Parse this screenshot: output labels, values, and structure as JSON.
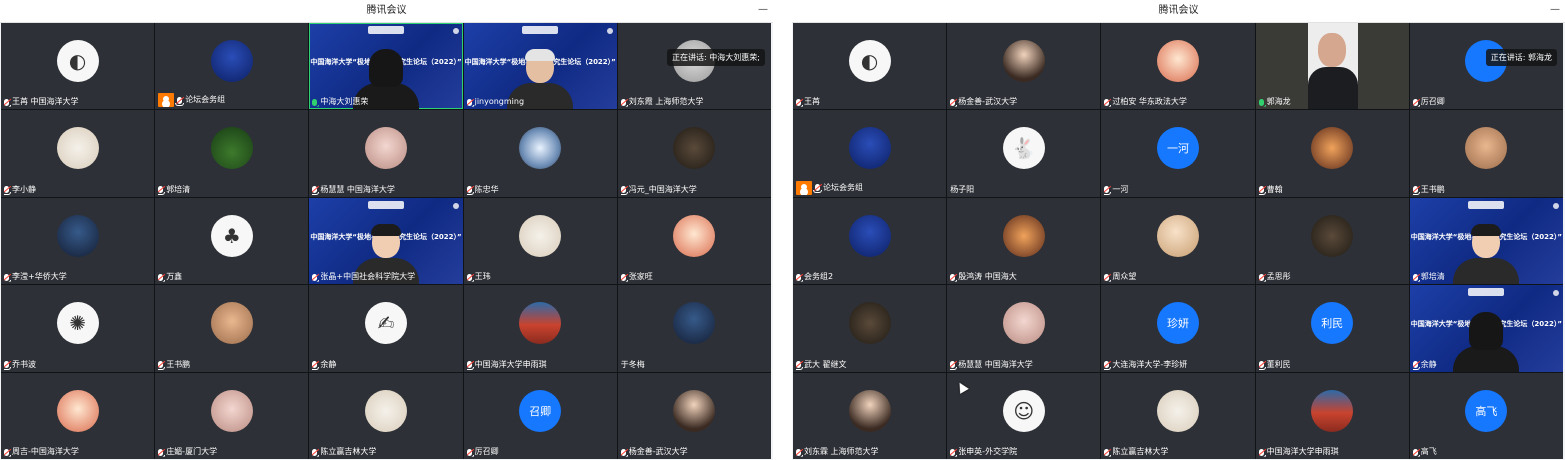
{
  "left": {
    "title": "腾讯会议",
    "speaking": "正在讲话: 中海大刘惠荣;",
    "tiles": [
      {
        "name": "王苒 中国海洋大学",
        "avatar": "white",
        "glyph": "◐",
        "mic": "muted"
      },
      {
        "name": "论坛会务组",
        "avatar": "navy",
        "host": true,
        "mic": "muted"
      },
      {
        "name": "中海大刘惠荣",
        "kind": "slide",
        "person": "women",
        "mic": "speaking",
        "highlight": true
      },
      {
        "name": "jinyongming",
        "kind": "slide",
        "person": "white-hair",
        "mic": "muted"
      },
      {
        "name": "刘东霞 上海师范大学",
        "avatar": "grey",
        "mic": "muted",
        "speaking_tag": true
      },
      {
        "name": "李小静",
        "avatar": "dog",
        "mic": "muted"
      },
      {
        "name": "郭培清",
        "avatar": "green",
        "mic": "muted"
      },
      {
        "name": "杨慧慧 中国海洋大学",
        "avatar": "pink",
        "mic": "muted"
      },
      {
        "name": "陈忠华",
        "avatar": "space",
        "mic": "muted"
      },
      {
        "name": "冯元_中国海洋大学",
        "avatar": "dark",
        "mic": "muted"
      },
      {
        "name": "李滢+华侨大学",
        "avatar": "night",
        "mic": "muted"
      },
      {
        "name": "万鑫",
        "avatar": "white",
        "glyph": "♣",
        "mic": "muted"
      },
      {
        "name": "张晶+中国社会科学院大学",
        "kind": "slide",
        "person": "glasses",
        "mic": "muted"
      },
      {
        "name": "王玮",
        "avatar": "dog",
        "mic": "muted"
      },
      {
        "name": "张家旺",
        "avatar": "cartoon",
        "mic": "muted"
      },
      {
        "name": "乔书波",
        "avatar": "white",
        "glyph": "✺",
        "mic": "muted"
      },
      {
        "name": "王书鹏",
        "avatar": "teddy",
        "mic": "muted"
      },
      {
        "name": "余静",
        "avatar": "white",
        "glyph": "✍",
        "mic": "muted"
      },
      {
        "name": "中国海洋大学申雨琪",
        "avatar": "wall",
        "mic": "muted"
      },
      {
        "name": "于冬梅",
        "avatar": "night",
        "mic": "none"
      },
      {
        "name": "周吉-中国海洋大学",
        "avatar": "cartoon",
        "mic": "muted"
      },
      {
        "name": "庄媚-厦门大学",
        "avatar": "pink",
        "mic": "muted"
      },
      {
        "name": "陈立赢吉林大学",
        "avatar": "dog",
        "mic": "muted"
      },
      {
        "name": "厉召卿",
        "avatar": "txt",
        "text": "召卿",
        "mic": "muted"
      },
      {
        "name": "杨金善-武汉大学",
        "avatar": "person",
        "mic": "muted"
      }
    ]
  },
  "right": {
    "title": "腾讯会议",
    "speaking": "正在讲话: 郭海龙",
    "tiles": [
      {
        "name": "王苒",
        "avatar": "white",
        "glyph": "◐",
        "mic": "muted"
      },
      {
        "name": "杨金善-武汉大学",
        "avatar": "person",
        "mic": "muted"
      },
      {
        "name": "过柏安 华东政法大学",
        "avatar": "cartoon",
        "mic": "muted"
      },
      {
        "name": "郭海龙",
        "kind": "camera",
        "mic": "speaking",
        "highlight": true
      },
      {
        "name": "厉召卿",
        "avatar": "txt",
        "text": "",
        "mic": "muted",
        "speaking_tag": true
      },
      {
        "name": "论坛会务组",
        "avatar": "navy",
        "host": true,
        "mic": "muted"
      },
      {
        "name": "杨子阳",
        "avatar": "white",
        "glyph": "🐇",
        "mic": "none"
      },
      {
        "name": "一河",
        "avatar": "txt",
        "text": "一河",
        "mic": "muted"
      },
      {
        "name": "曹翰",
        "avatar": "sunset",
        "mic": "muted"
      },
      {
        "name": "王书鹏",
        "avatar": "teddy",
        "mic": "muted"
      },
      {
        "name": "会务组2",
        "avatar": "navy",
        "mic": "muted"
      },
      {
        "name": "殷鸿涛 中国海大",
        "avatar": "sunset",
        "mic": "muted"
      },
      {
        "name": "周众望",
        "avatar": "cream",
        "mic": "muted"
      },
      {
        "name": "孟思彤",
        "avatar": "dark",
        "mic": "muted"
      },
      {
        "name": "郭培清",
        "kind": "slide",
        "person": "glasses",
        "mic": "muted"
      },
      {
        "name": "武大 翟继文",
        "avatar": "dark",
        "mic": "muted"
      },
      {
        "name": "杨慧慧 中国海洋大学",
        "avatar": "pink",
        "mic": "muted"
      },
      {
        "name": "大连海洋大学-李珍妍",
        "avatar": "txt",
        "text": "珍妍",
        "mic": "muted"
      },
      {
        "name": "董利民",
        "avatar": "txt",
        "text": "利民",
        "mic": "muted"
      },
      {
        "name": "余静",
        "kind": "slide",
        "person": "women",
        "mic": "muted"
      },
      {
        "name": "刘东霖 上海师范大学",
        "avatar": "person",
        "mic": "muted"
      },
      {
        "name": "张申英-外交学院",
        "avatar": "white",
        "glyph": "☺",
        "mic": "muted"
      },
      {
        "name": "陈立赢吉林大学",
        "avatar": "dog",
        "mic": "muted"
      },
      {
        "name": "中国海洋大学申雨琪",
        "avatar": "wall",
        "mic": "muted"
      },
      {
        "name": "高飞",
        "avatar": "txt",
        "text": "高飞",
        "mic": "muted"
      }
    ]
  },
  "slide_title": "中国海洋大学“极地与海洋研究生论坛（2022）”",
  "minimize": "—"
}
